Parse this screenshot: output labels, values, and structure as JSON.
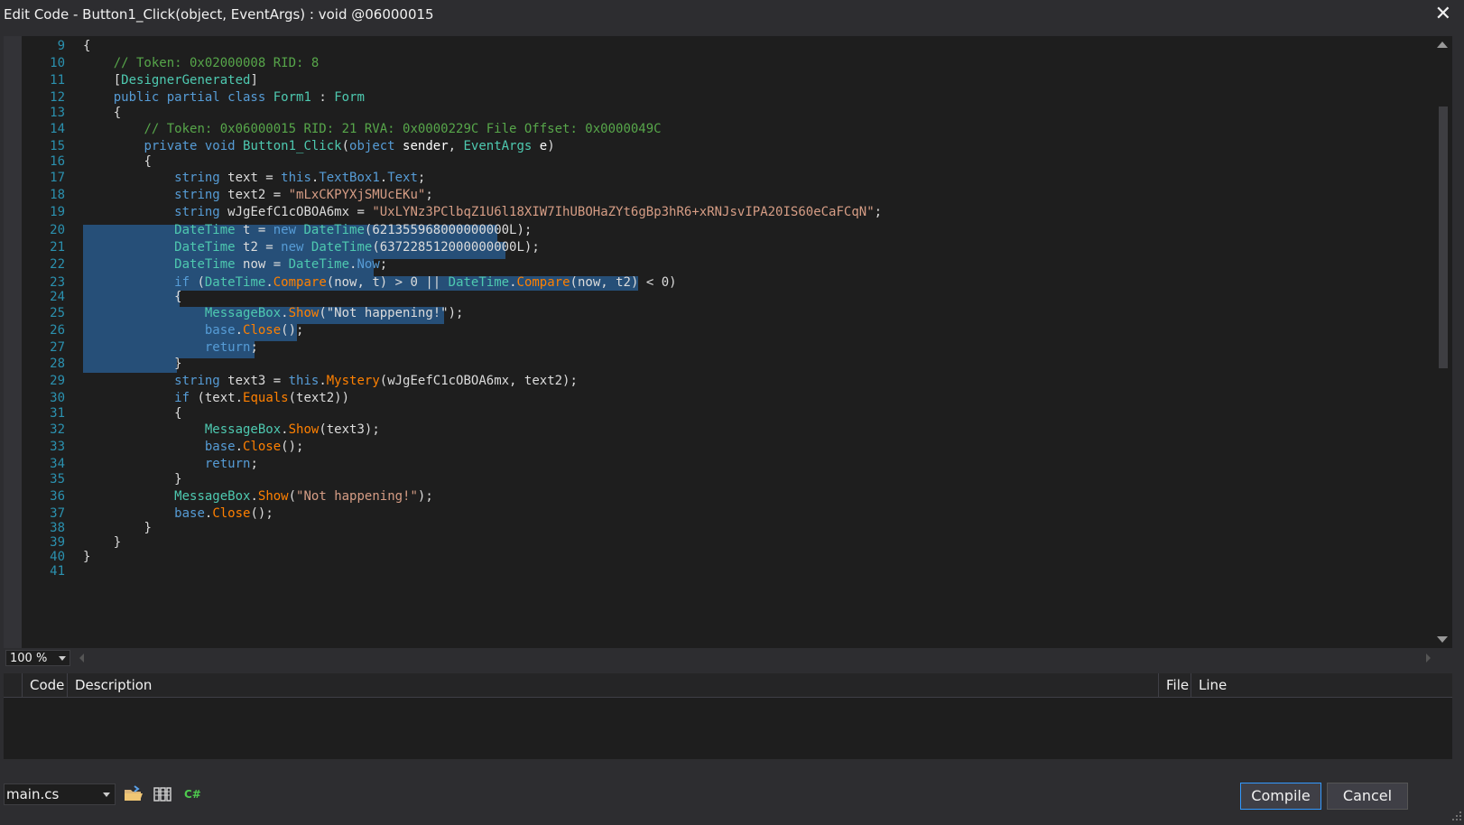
{
  "window": {
    "title": "Edit Code - Button1_Click(object, EventArgs) : void @06000015"
  },
  "editor": {
    "line_numbers": [
      "9",
      "10",
      "11",
      "12",
      "13",
      "14",
      "15",
      "16",
      "17",
      "18",
      "19",
      "20",
      "21",
      "22",
      "23",
      "24",
      "25",
      "26",
      "27",
      "28",
      "29",
      "30",
      "31",
      "32",
      "33",
      "34",
      "35",
      "36",
      "37",
      "38",
      "39",
      "40",
      "41"
    ],
    "zoom": "100 %"
  },
  "code": {
    "l10": "// Token: 0x02000008 RID: 8",
    "l11_attr": "DesignerGenerated",
    "l12_class": "Form1",
    "l12_base": "Form",
    "l14": "// Token: 0x06000015 RID: 21 RVA: 0x0000229C File Offset: 0x0000049C",
    "l15_method": "Button1_Click",
    "l15_param1": "sender",
    "l15_type2": "EventArgs",
    "l15_param2": "e",
    "l17_member1": "TextBox1",
    "l17_member2": "Text",
    "l18_str": "\"mLxCKPYXjSMUcEKu\"",
    "l19_var": "wJgEefC1cOBOA6mx",
    "l19_str": "\"UxLYNz3PClbqZ1U6l18XIW7IhUBOHaZYt6gBp3hR6+xRNJsvIPA20IS60eCaFCqN\"",
    "l20_num": "621355968000000000L",
    "l21_num": "637228512000000000L",
    "l22_now": "Now",
    "l23_zero1": "0",
    "l23_zero2": "0",
    "l25_str": "\"Not happening!\"",
    "l29_method": "Mystery",
    "l30_method": "Equals",
    "l36_str": "\"Not happening!\""
  },
  "error_list": {
    "columns": [
      "Code",
      "Description",
      "File",
      "Line"
    ]
  },
  "footer": {
    "file": "main.cs",
    "compile": "Compile",
    "cancel": "Cancel"
  },
  "colors": {
    "keyword": "#569cd6",
    "type": "#4ec9b0",
    "method": "#ff8000",
    "string": "#d69d85",
    "comment": "#57a64a",
    "selection": "#264f78"
  },
  "icons": [
    "close-icon",
    "open-file-icon",
    "references-icon",
    "csharp-icon"
  ]
}
